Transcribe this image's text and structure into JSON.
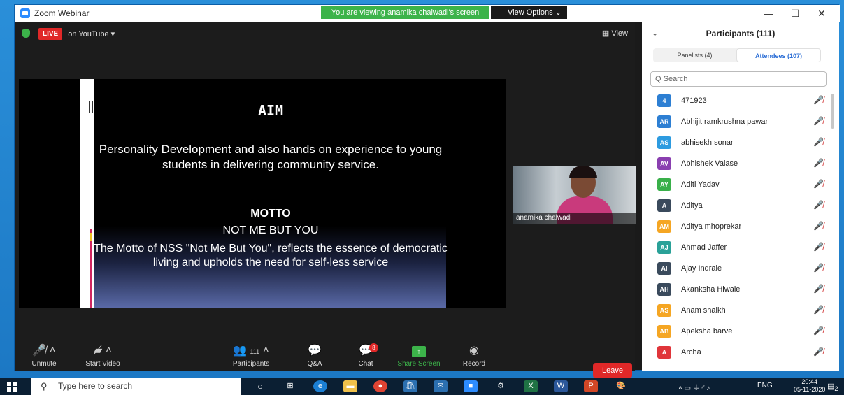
{
  "window": {
    "title": "Zoom Webinar",
    "viewing_banner": "You are viewing anamika chalwadi's screen",
    "view_options": "View Options ⌄",
    "controls": [
      "—",
      "☐",
      "✕"
    ]
  },
  "meeting": {
    "live_label": "LIVE",
    "live_target": "on YouTube ▾",
    "view_label": "View",
    "slide": {
      "aim": "AIM",
      "description": "Personality Development and also hands on experience to young students in delivering community service.",
      "motto_title": "MOTTO",
      "motto_line": "NOT ME BUT YOU",
      "motto_text": "The Motto of NSS \"Not Me But You\", reflects the essence of democratic living and upholds the need for self-less service"
    },
    "video_name": "anamika chalwadi",
    "toolbar": {
      "unmute": "Unmute",
      "start_video": "Start Video",
      "participants": "Participants",
      "participants_count": "111",
      "qa": "Q&A",
      "chat": "Chat",
      "chat_badge": "8",
      "share": "Share Screen",
      "record": "Record",
      "leave": "Leave"
    }
  },
  "panel": {
    "title": "Participants (111)",
    "tabs": [
      "Panelists (4)",
      "Attendees (107)"
    ],
    "search_placeholder": "Q Search",
    "participants": [
      {
        "initials": "4",
        "name": "471923",
        "color": "#2d7fd3"
      },
      {
        "initials": "AR",
        "name": "Abhijit ramkrushna  pawar",
        "color": "#2d7fd3"
      },
      {
        "initials": "AS",
        "name": "abhisekh sonar",
        "color": "#2d9be0"
      },
      {
        "initials": "AV",
        "name": "Abhishek Valase",
        "color": "#8a3fb0"
      },
      {
        "initials": "AY",
        "name": "Aditi Yadav",
        "color": "#39b04a"
      },
      {
        "initials": "A",
        "name": "Aditya",
        "color": "#3a4a5c"
      },
      {
        "initials": "AM",
        "name": "Aditya mhoprekar",
        "color": "#f5a623"
      },
      {
        "initials": "AJ",
        "name": "Ahmad Jaffer",
        "color": "#2aa198"
      },
      {
        "initials": "AI",
        "name": "Ajay Indrale",
        "color": "#3a4a5c"
      },
      {
        "initials": "AH",
        "name": "Akanksha Hiwale",
        "color": "#3a4a5c"
      },
      {
        "initials": "AS",
        "name": "Anam shaikh",
        "color": "#f5a623"
      },
      {
        "initials": "AB",
        "name": "Apeksha barve",
        "color": "#f5a623"
      },
      {
        "initials": "A",
        "name": "Archa",
        "color": "#e0353a"
      }
    ]
  },
  "taskbar": {
    "search_placeholder": "Type here to search",
    "lang": "ENG",
    "time": "20:44",
    "date": "05-11-2020",
    "notif": "2"
  }
}
